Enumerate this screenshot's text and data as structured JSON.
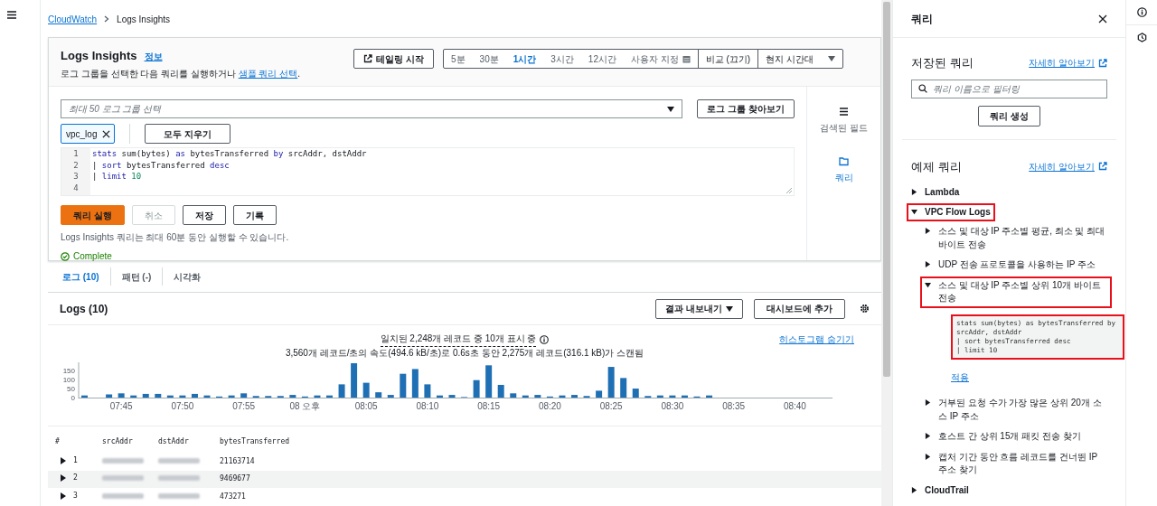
{
  "breadcrumb": [
    {
      "label": "CloudWatch",
      "kind": "link"
    },
    {
      "label": "Logs Insights",
      "kind": "current"
    }
  ],
  "header": {
    "title": "Logs Insights",
    "info": "정보",
    "description": "로그 그룹을 선택한 다음 쿼리를 실행하거나 ",
    "description_link": "샘플 쿼리 선택",
    "description_end": ".",
    "tail_button": "테일링 시작",
    "compare_button": "비교 (끄기)",
    "timezone": "현지 시간대"
  },
  "time_ranges": [
    {
      "label": "5분",
      "kind": "preset",
      "selected": false
    },
    {
      "label": "30분",
      "kind": "preset",
      "selected": false
    },
    {
      "label": "1시간",
      "kind": "preset",
      "selected": true
    },
    {
      "label": "3시간",
      "kind": "preset",
      "selected": false
    },
    {
      "label": "12시간",
      "kind": "preset",
      "selected": false
    },
    {
      "label": "사용자 지정",
      "kind": "custom",
      "selected": false
    }
  ],
  "log_group_select": {
    "placeholder": "최대 50 로그 그룹 선택"
  },
  "browse_button": "로그 그룹 찾아보기",
  "selected_groups": [
    {
      "label": "vpc_log"
    }
  ],
  "clear_all": "모두 지우기",
  "editor": {
    "lines": [
      {
        "number": "1",
        "tokens": [
          {
            "text": "stats",
            "kind": "keyword"
          },
          {
            "text": " sum(bytes) ",
            "kind": "text"
          },
          {
            "text": "as",
            "kind": "keyword"
          },
          {
            "text": " bytesTransferred ",
            "kind": "text"
          },
          {
            "text": "by",
            "kind": "keyword"
          },
          {
            "text": " srcAddr, dstAddr",
            "kind": "text"
          }
        ]
      },
      {
        "number": "2",
        "tokens": [
          {
            "text": "| ",
            "kind": "text"
          },
          {
            "text": "sort",
            "kind": "keyword"
          },
          {
            "text": " bytesTransferred ",
            "kind": "text"
          },
          {
            "text": "desc",
            "kind": "keyword"
          }
        ]
      },
      {
        "number": "3",
        "tokens": [
          {
            "text": "| ",
            "kind": "text"
          },
          {
            "text": "limit",
            "kind": "keyword"
          },
          {
            "text": " 10",
            "kind": "number"
          }
        ]
      },
      {
        "number": "4"
      }
    ]
  },
  "actions": [
    {
      "label": "쿼리 실행",
      "kind": "primary"
    },
    {
      "label": "취소",
      "kind": "disabled"
    },
    {
      "label": "저장",
      "kind": "normal"
    },
    {
      "label": "기록",
      "kind": "normal"
    }
  ],
  "note": "Logs Insights 쿼리는 최대 60분 동안 실행할 수 있습니다.",
  "status": "Complete",
  "side_rail": [
    {
      "label": "검색된 필드",
      "kind": "fields",
      "selected": false
    },
    {
      "label": "쿼리",
      "kind": "queries",
      "selected": true
    }
  ],
  "result_tabs": [
    {
      "label": "로그 (10)",
      "selected": true
    },
    {
      "label": "패턴 (-)",
      "selected": false
    },
    {
      "label": "시각화",
      "selected": false
    }
  ],
  "logs": {
    "title": "Logs (10)",
    "export_button": "결과 내보내기",
    "dashboard_button": "대시보드에 추가",
    "summary": "일치된 2,248개 레코드 중 10개 표시 중",
    "scan_info": "3,560개 레코드/초의 속도(494.6 kB/초)로 0.6s초 동안 2,275개 레코드(316.1 kB)가 스캔됨",
    "hide_histogram": "히스토그램 숨기기",
    "chart_data": {
      "type": "bar",
      "categories": [
        null,
        null,
        null,
        "07:45",
        null,
        null,
        null,
        null,
        "07:50",
        null,
        null,
        null,
        null,
        "07:55",
        null,
        null,
        null,
        null,
        "08 오후",
        null,
        null,
        null,
        null,
        "08:05",
        null,
        null,
        null,
        null,
        "08:10",
        null,
        null,
        null,
        null,
        "08:15",
        null,
        null,
        null,
        null,
        "08:20",
        null,
        null,
        null,
        null,
        "08:25",
        null,
        null,
        null,
        null,
        "08:30",
        null,
        null,
        null,
        null,
        "08:35",
        null,
        null,
        null,
        null,
        "08:40",
        null,
        null
      ],
      "series": [
        {
          "color": "#1f6fb5",
          "values": [
            12,
            null,
            18,
            24,
            12,
            21,
            21,
            12,
            12,
            21,
            12,
            6,
            12,
            24,
            9,
            9,
            9,
            15,
            6,
            12,
            12,
            75,
            195,
            84,
            30,
            15,
            135,
            162,
            75,
            12,
            15,
            3,
            99,
            183,
            72,
            24,
            12,
            15,
            6,
            12,
            15,
            9,
            39,
            174,
            111,
            51,
            9,
            12,
            12,
            12,
            6,
            12,
            null,
            null,
            null,
            null,
            null,
            null,
            null,
            null,
            null
          ]
        }
      ],
      "ylim": [
        0,
        200
      ],
      "yticks": [
        0,
        50,
        100,
        150
      ]
    },
    "table": {
      "columns": [
        "#",
        "srcAddr",
        "dstAddr",
        "bytesTransferred"
      ],
      "rows": [
        {
          "number": "1",
          "bytesTransferred": "21163714"
        },
        {
          "number": "2",
          "bytesTransferred": "9469677"
        },
        {
          "number": "3",
          "bytesTransferred": "473271"
        }
      ]
    }
  },
  "panel": {
    "title": "쿼리",
    "saved": {
      "title": "저장된 쿼리",
      "learn_more": "자세히 알아보기",
      "filter_placeholder": "쿼리 이름으로 필터링",
      "create_button": "쿼리 생성"
    },
    "examples": {
      "title": "예제 쿼리",
      "learn_more": "자세히 알아보기",
      "tree": [
        {
          "label": "Lambda",
          "expanded": false,
          "highlighted": false
        },
        {
          "label": "VPC Flow Logs",
          "expanded": true,
          "highlighted": true,
          "children": [
            {
              "label": "소스 및 대상 IP 주소별 평균, 최소 및 최대 바이트 전송",
              "expanded": false,
              "highlighted": false
            },
            {
              "label": "UDP 전송 프로토콜을 사용하는 IP 주소",
              "expanded": false,
              "highlighted": false
            },
            {
              "label": "소스 및 대상 IP 주소별 상위 10개 바이트 전송",
              "expanded": true,
              "highlighted": true,
              "code_highlighted": true,
              "code": [
                "stats sum(bytes) as bytesTransferred by srcAddr, dstAddr",
                "| sort bytesTransferred desc",
                "| limit 10"
              ],
              "apply": "적용"
            },
            {
              "label": "거부된 요청 수가 가장 많은 상위 20개 소스 IP 주소",
              "expanded": false,
              "highlighted": false
            },
            {
              "label": "호스트 간 상위 15개 패킷 전송 찾기",
              "expanded": false,
              "highlighted": false
            },
            {
              "label": "캡처 기간 동안 흐름 레코드를 건너뛴 IP 주소 찾기",
              "expanded": false,
              "highlighted": false
            }
          ]
        },
        {
          "label": "CloudTrail",
          "expanded": false,
          "highlighted": false
        }
      ]
    }
  }
}
